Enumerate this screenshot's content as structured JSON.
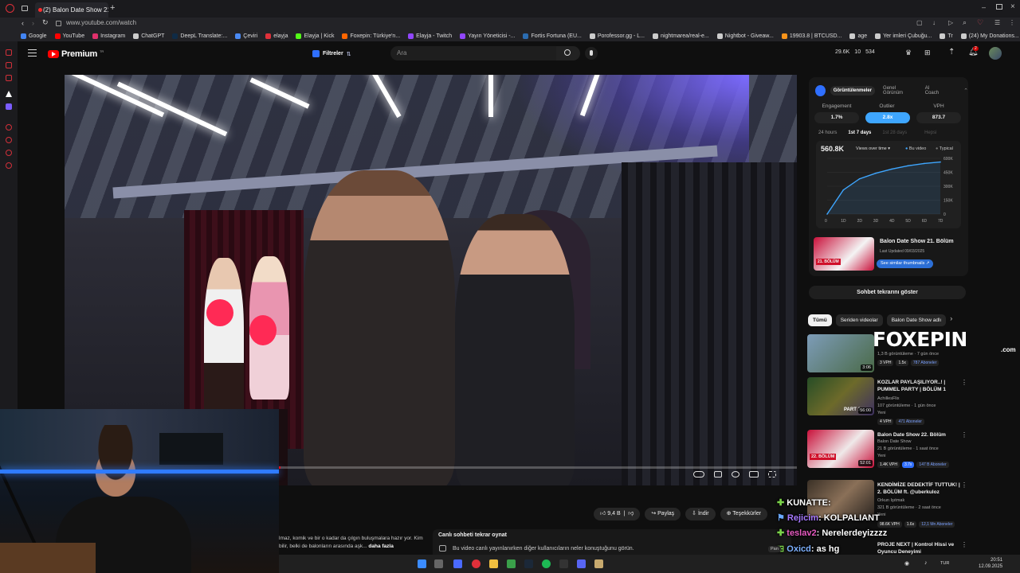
{
  "browser": {
    "tab_title": "(2) Balon Date Show 21. B",
    "url": "www.youtube.com/watch",
    "bookmarks": [
      "Google",
      "YouTube",
      "Instagram",
      "ChatGPT",
      "DeepL Translate:...",
      "Çeviri",
      "elayja",
      "Elayja | Kick",
      "Foxepin: Türkiye'n...",
      "Elayja - Twitch",
      "Yayın Yöneticisi -...",
      "Fortis Fortuna (EU...",
      "Porofessor.gg - L...",
      "nightmarea/real-e...",
      "Nightbot - Giveaw...",
      "19903.8 | BTCUSD...",
      "age",
      "Yer imleri Çubuğu...",
      "Tr",
      "(24) My Donations..."
    ]
  },
  "header": {
    "logo_text": "Premium",
    "filters_label": "Filtreler",
    "search_placeholder": "Ara",
    "stats": [
      "29.6K",
      "10",
      "534"
    ],
    "notif_count": "2"
  },
  "video_actions": {
    "likes": "9,4 B",
    "share": "Paylaş",
    "download": "İndir",
    "thanks": "Teşekkürler"
  },
  "description": {
    "text": "lmaz, komik ve bir o kadar da çılgın buluşmalara hazır yor. Kim bilir, belki de balonların arasında aşk...",
    "more": "daha fazla"
  },
  "chat_replay": {
    "title": "Canlı sohbeti tekrar oynat",
    "body": "Bu video canlı yayınlanırken diğer kullanıcıların neler konuştuğunu görün."
  },
  "ext": {
    "tabs": [
      "Görüntülenmeler",
      "Genel Görünüm",
      "AI Coach"
    ],
    "metrics": [
      {
        "label": "Engagement",
        "value": "1.7%"
      },
      {
        "label": "Outlier",
        "value": "2.8x"
      },
      {
        "label": "VPH",
        "value": "873.7"
      }
    ],
    "periods": [
      "24 hours",
      "1st 7 days",
      "1st 28 days",
      "Hepsi"
    ],
    "views_total": "560.8K",
    "views_dropdown": "Views over time",
    "legend_this": "Bu video",
    "legend_typical": "Typical",
    "card_title": "Balon Date Show 21. Bölüm",
    "card_updated": "Last Updated 09/03/2025",
    "card_btn": "See similar thumbnails",
    "thumb_badge": "21. BÖLÜM"
  },
  "chart_data": {
    "type": "line",
    "x": [
      0,
      1,
      2,
      3,
      4,
      5,
      6,
      7
    ],
    "xticks": [
      "0",
      "1D",
      "2D",
      "3D",
      "4D",
      "5D",
      "6D",
      "7D"
    ],
    "series": [
      {
        "values": [
          0,
          260000,
          380000,
          440000,
          485000,
          520000,
          545000,
          560800
        ]
      }
    ],
    "yticks": [
      "600K",
      "450K",
      "300K",
      "150K",
      "0"
    ],
    "ylim": [
      0,
      600000
    ],
    "color": "#3ea6ff"
  },
  "chat_show": "Sohbet tekrarını göster",
  "chips": [
    "Tümü",
    "Seriden videolar",
    "Balon Date Show adlı"
  ],
  "recs": [
    {
      "title": "",
      "meta1": "1,3 B görüntüleme · 7 gün önce",
      "tags": [
        "3 VPH",
        "1.5x",
        "787 Aboneler"
      ],
      "duration": "3:06",
      "color": "#5c7a9c"
    },
    {
      "title": "KOZLAR PAYLAŞILIYOR..! | PUMMEL PARTY | BÖLÜM 1",
      "meta1": "AchillesFlix",
      "meta2": "107 görüntüleme · 1 gün önce",
      "meta3": "Yeni",
      "tags": [
        "4 VPH",
        "471 Aboneler"
      ],
      "duration": "56:00",
      "badge": "PART 1",
      "color": "#3a6d3a"
    },
    {
      "title": "Balon Date Show 22. Bölüm",
      "meta1": "Balon Date Show",
      "meta2": "21 B görüntüleme · 1 saat önce",
      "meta3": "Yeni",
      "tags": [
        "1.4K VPH",
        "3.7x",
        "147 B Aboneler"
      ],
      "duration": "52:01",
      "badge": "22. BÖLÜM",
      "color": "#c9103a"
    },
    {
      "title": "KENDİMİZE DEDEKTİF TUTTUK! | 2. BÖLÜM ft. @uberkuloz",
      "meta1": "Orkun Işıtmak",
      "meta2": "321 B görüntüleme · 2 saat önce",
      "meta3": "Yeni",
      "tags": [
        "98.6K VPH",
        "1.6x",
        "12,1 Mn Aboneler"
      ],
      "duration": "",
      "color": "#6b5a48"
    },
    {
      "title": "PROJE NEXT | Kontrol Hissi ve Oyuncu Deneyimi",
      "meta1": "",
      "tags": [],
      "duration": "",
      "color": "#333"
    }
  ],
  "watermark": {
    "brand": "FOXEPIN",
    "tld": ".com"
  },
  "overlay_chat": [
    {
      "user": "KUNATTE",
      "msg": ":"
    },
    {
      "user": "Rejicim",
      "msg": ": KOLPALIANT"
    },
    {
      "user": "teslav2",
      "msg": ": Nerelerdeyizzzz"
    },
    {
      "user": "Oxicd",
      "msg": ": as hg"
    },
    {
      "user": "Oxicd",
      "msg": ": as hg"
    }
  ],
  "taskbar": {
    "lang": "TUR",
    "time": "20:51",
    "date": "12.09.2025",
    "tray_label": "Pan"
  }
}
